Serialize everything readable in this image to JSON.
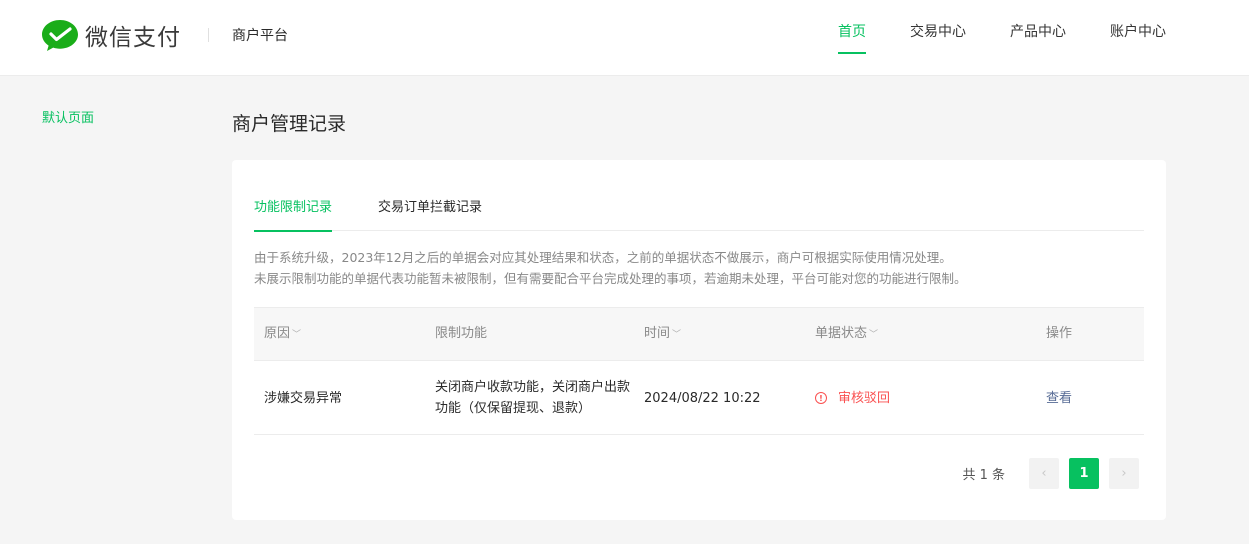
{
  "header": {
    "brand": "微信支付",
    "platform": "商户平台",
    "nav": [
      {
        "label": "首页",
        "active": true
      },
      {
        "label": "交易中心",
        "active": false
      },
      {
        "label": "产品中心",
        "active": false
      },
      {
        "label": "账户中心",
        "active": false
      }
    ]
  },
  "sidebar": {
    "items": [
      {
        "label": "默认页面",
        "active": true
      }
    ]
  },
  "main": {
    "title": "商户管理记录",
    "tabs": [
      {
        "label": "功能限制记录",
        "active": true
      },
      {
        "label": "交易订单拦截记录",
        "active": false
      }
    ],
    "notice": [
      "由于系统升级，2023年12月之后的单据会对应其处理结果和状态，之前的单据状态不做展示，商户可根据实际使用情况处理。",
      "未展示限制功能的单据代表功能暂未被限制，但有需要配合平台完成处理的事项，若逾期未处理，平台可能对您的功能进行限制。"
    ],
    "table": {
      "columns": [
        "原因",
        "限制功能",
        "时间",
        "单据状态",
        "操作"
      ],
      "rows": [
        {
          "reason": "涉嫌交易异常",
          "function": "关闭商户收款功能，关闭商户出款功能（仅保留提现、退款）",
          "time": "2024/08/22 10:22",
          "status": "审核驳回",
          "action": "查看"
        }
      ]
    },
    "pagination": {
      "total": "共 1 条",
      "current": "1",
      "prev": "‹",
      "next": "›"
    }
  },
  "colors": {
    "accent": "#07c160",
    "danger": "#fa5151",
    "link": "#576b95"
  }
}
